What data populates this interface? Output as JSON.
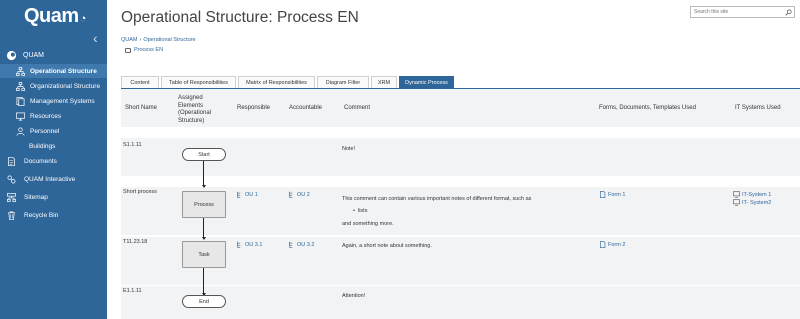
{
  "sidebar": {
    "logo": "Quam",
    "root": "QUAM",
    "items": [
      {
        "label": "Operational Structure",
        "icon": "org-chart-icon"
      },
      {
        "label": "Organizational Structure",
        "icon": "org-chart-icon"
      },
      {
        "label": "Management Systems",
        "icon": "document-stack-icon"
      },
      {
        "label": "Resources",
        "icon": "resources-icon"
      },
      {
        "label": "Personnel",
        "icon": "people-icon"
      },
      {
        "label": "Buildings",
        "icon": ""
      },
      {
        "label": "Documents",
        "icon": "documents-icon"
      },
      {
        "label": "QUAM Interactive",
        "icon": "interactive-icon"
      },
      {
        "label": "Sitemap",
        "icon": "sitemap-icon"
      },
      {
        "label": "Recycle Bin",
        "icon": "trash-icon"
      }
    ]
  },
  "header": {
    "title": "Operational Structure: Process EN",
    "search_placeholder": "Search this site"
  },
  "breadcrumb": {
    "root": "QUAM",
    "separator": "›",
    "current": "Operational Structure"
  },
  "subpage": "Process EN",
  "tabs": [
    {
      "label": "Content"
    },
    {
      "label": "Table of Responsibilities"
    },
    {
      "label": "Matrix of Responsibilities"
    },
    {
      "label": "Diagram Filter"
    },
    {
      "label": "XRM"
    },
    {
      "label": "Dynamic Process"
    }
  ],
  "table": {
    "headers": {
      "short_name": "Short Name",
      "assigned": "Assigned Elements (Operational Structure)",
      "responsible": "Responsible",
      "accountable": "Accountable",
      "comment": "Comment",
      "forms": "Forms, Documents, Templates Used",
      "it": "IT Systems Used"
    },
    "rows": [
      {
        "short": "S1.1.11",
        "shape": "Start",
        "responsible": "",
        "accountable": "",
        "comment": "Note!",
        "form": "",
        "it": []
      },
      {
        "short": "Short process",
        "shape": "Process",
        "responsible": "OU 1",
        "accountable": "OU 2",
        "comment": "This comment can contain various important notes of different format, such as",
        "bullet": "lists",
        "comment_tail": "and something more.",
        "form": "Form 1",
        "it": [
          "IT-System 1",
          "IT- System2"
        ]
      },
      {
        "short": "T11.23.18",
        "shape": "Task",
        "responsible": "OU 3.1",
        "accountable": "OU 3.2",
        "comment": "Again, a short note about something.",
        "form": "Form 2",
        "it": []
      },
      {
        "short": "E1.1.11",
        "shape": "End",
        "responsible": "",
        "accountable": "",
        "comment": "Attention!",
        "form": "",
        "it": []
      }
    ]
  },
  "colors": {
    "accent": "#2f6699",
    "band": "#f1f3f5"
  }
}
